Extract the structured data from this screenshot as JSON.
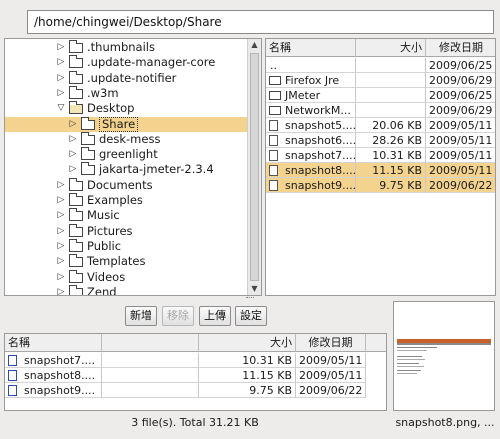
{
  "path": {
    "value": "/home/chingwei/Desktop/Share"
  },
  "tree": [
    {
      "label": ".thumbnails",
      "depth": 2,
      "arrow": "▷",
      "selected": false
    },
    {
      "label": ".update-manager-core",
      "depth": 2,
      "arrow": "▷",
      "selected": false
    },
    {
      "label": ".update-notifier",
      "depth": 2,
      "arrow": "▷",
      "selected": false
    },
    {
      "label": ".w3m",
      "depth": 2,
      "arrow": "▷",
      "selected": false
    },
    {
      "label": "Desktop",
      "depth": 2,
      "arrow": "▽",
      "selected": false,
      "open": true
    },
    {
      "label": "Share",
      "depth": 3,
      "arrow": "▷",
      "selected": true
    },
    {
      "label": "desk-mess",
      "depth": 3,
      "arrow": "▷",
      "selected": false
    },
    {
      "label": "greenlight",
      "depth": 3,
      "arrow": "▷",
      "selected": false
    },
    {
      "label": "jakarta-jmeter-2.3.4",
      "depth": 3,
      "arrow": "▷",
      "selected": false
    },
    {
      "label": "Documents",
      "depth": 2,
      "arrow": "▷",
      "selected": false
    },
    {
      "label": "Examples",
      "depth": 2,
      "arrow": "▷",
      "selected": false
    },
    {
      "label": "Music",
      "depth": 2,
      "arrow": "▷",
      "selected": false
    },
    {
      "label": "Pictures",
      "depth": 2,
      "arrow": "▷",
      "selected": false
    },
    {
      "label": "Public",
      "depth": 2,
      "arrow": "▷",
      "selected": false
    },
    {
      "label": "Templates",
      "depth": 2,
      "arrow": "▷",
      "selected": false
    },
    {
      "label": "Videos",
      "depth": 2,
      "arrow": "▷",
      "selected": false
    },
    {
      "label": "Zend",
      "depth": 2,
      "arrow": "▷",
      "selected": false
    }
  ],
  "file_list": {
    "headers": {
      "name": "名稱",
      "size": "大小",
      "date": "修改日期"
    },
    "rows": [
      {
        "name": "..",
        "size": "",
        "date": "2009/06/25",
        "kind": "none",
        "selected": false
      },
      {
        "name": "Firefox Jre",
        "size": "",
        "date": "2009/06/29",
        "kind": "folder",
        "selected": false
      },
      {
        "name": "JMeter",
        "size": "",
        "date": "2009/06/25",
        "kind": "folder",
        "selected": false
      },
      {
        "name": "NetworkM...",
        "size": "",
        "date": "2009/06/29",
        "kind": "folder",
        "selected": false
      },
      {
        "name": "snapshot5....",
        "size": "20.06 KB",
        "date": "2009/05/11",
        "kind": "doc",
        "selected": false
      },
      {
        "name": "snapshot6....",
        "size": "28.26 KB",
        "date": "2009/05/11",
        "kind": "doc",
        "selected": false
      },
      {
        "name": "snapshot7....",
        "size": "10.31 KB",
        "date": "2009/05/11",
        "kind": "doc",
        "selected": false
      },
      {
        "name": "snapshot8....",
        "size": "11.15 KB",
        "date": "2009/05/11",
        "kind": "doc",
        "selected": true
      },
      {
        "name": "snapshot9....",
        "size": "9.75 KB",
        "date": "2009/06/22",
        "kind": "doc",
        "selected": true
      }
    ]
  },
  "buttons": {
    "add": "新增",
    "remove": "移除",
    "upload": "上傳",
    "settings": "設定"
  },
  "queue": {
    "headers": {
      "name": "名稱",
      "size": "大小",
      "date": "修改日期"
    },
    "rows": [
      {
        "name": "snapshot7....",
        "size": "10.31 KB",
        "date": "2009/05/11"
      },
      {
        "name": "snapshot8....",
        "size": "11.15 KB",
        "date": "2009/05/11"
      },
      {
        "name": "snapshot9....",
        "size": "9.75 KB",
        "date": "2009/06/22"
      }
    ]
  },
  "status": {
    "summary": "3 file(s). Total 31.21 KB"
  },
  "preview": {
    "filename": "snapshot8.png, ..."
  },
  "colors": {
    "selection": "#f4d38f",
    "background": "#edeceb"
  }
}
